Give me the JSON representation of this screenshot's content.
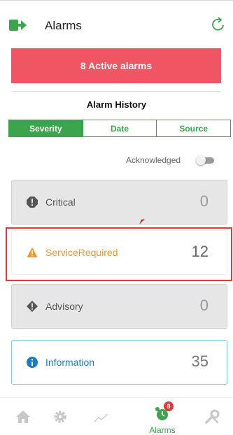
{
  "header": {
    "title": "Alarms"
  },
  "banner": {
    "text": "8 Active alarms"
  },
  "history": {
    "title": "Alarm History"
  },
  "tabs": [
    {
      "label": "Severity",
      "active": true
    },
    {
      "label": "Date",
      "active": false
    },
    {
      "label": "Source",
      "active": false
    }
  ],
  "acknowledged": {
    "label": "Acknowledged",
    "enabled": false
  },
  "cards": {
    "critical": {
      "label": "Critical",
      "count": "0",
      "icon": "critical-icon"
    },
    "service": {
      "label": "ServiceRequired",
      "count": "12",
      "icon": "warning-icon"
    },
    "advisory": {
      "label": "Advisory",
      "count": "0",
      "icon": "advisory-icon"
    },
    "information": {
      "label": "Information",
      "count": "35",
      "icon": "info-icon"
    }
  },
  "nav": {
    "alarms_label": "Alarms",
    "alarms_badge": "8"
  },
  "colors": {
    "accent": "#3aa54a",
    "banner": "#f05563",
    "warning": "#f0962c",
    "info": "#1d7dbc"
  }
}
